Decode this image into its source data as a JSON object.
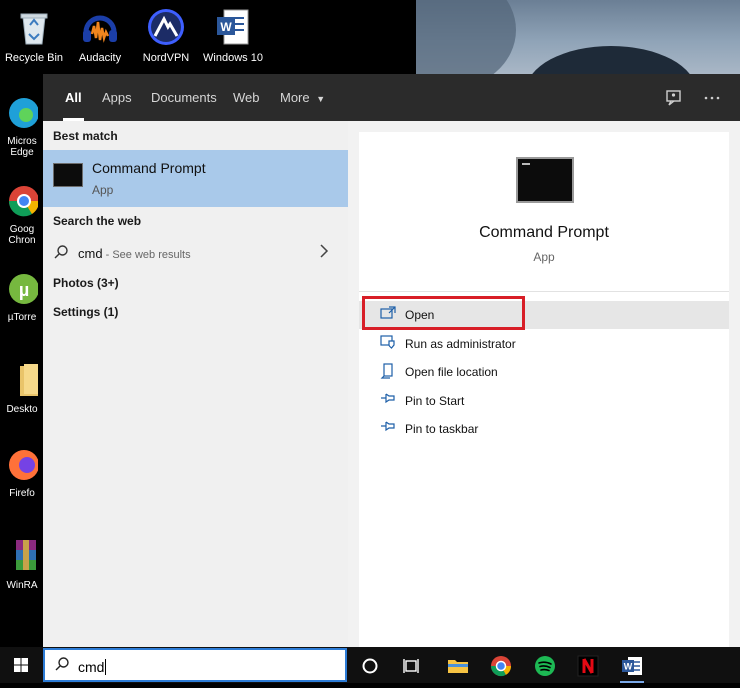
{
  "desktop": {
    "icons": [
      {
        "label": "Recycle Bin",
        "icon": "recycle-bin-icon"
      },
      {
        "label": "Audacity",
        "icon": "audacity-icon"
      },
      {
        "label": "NordVPN",
        "icon": "nordvpn-icon"
      },
      {
        "label": "Windows 10",
        "icon": "word-document-icon"
      }
    ],
    "side_icons": [
      {
        "label": "Micros Edge",
        "line1": "Micros",
        "line2": "Edge",
        "icon": "edge-icon"
      },
      {
        "label": "Goog Chron",
        "line1": "Goog",
        "line2": "Chron",
        "icon": "chrome-icon"
      },
      {
        "label": "µTorre",
        "line1": "µTorre",
        "line2": "",
        "icon": "utorrent-icon"
      },
      {
        "label": "Deskto",
        "line1": "Deskto",
        "line2": "",
        "icon": "folder-icon"
      },
      {
        "label": "Firefo",
        "line1": "Firefo",
        "line2": "",
        "icon": "firefox-icon"
      },
      {
        "label": "WinRA",
        "line1": "WinRA",
        "line2": "",
        "icon": "winrar-icon"
      }
    ]
  },
  "search": {
    "tabs": [
      "All",
      "Apps",
      "Documents",
      "Web",
      "More"
    ],
    "more_arrow": "▼",
    "feedback_icon": "feedback-icon",
    "options_icon": "more-options-icon",
    "best_match_header": "Best match",
    "best_match": {
      "name": "Command Prompt",
      "type": "App"
    },
    "web_header": "Search the web",
    "web_query": "cmd",
    "web_suffix": " - See web results",
    "photos": "Photos (3+)",
    "settings": "Settings (1)",
    "detail": {
      "name": "Command Prompt",
      "type": "App",
      "actions": [
        {
          "label": "Open",
          "icon": "open-icon"
        },
        {
          "label": "Run as administrator",
          "icon": "shield-admin-icon"
        },
        {
          "label": "Open file location",
          "icon": "file-location-icon"
        },
        {
          "label": "Pin to Start",
          "icon": "pin-icon"
        },
        {
          "label": "Pin to taskbar",
          "icon": "pin-icon"
        }
      ]
    },
    "query": "cmd"
  },
  "colors": {
    "selection": "#a9c9ea",
    "highlight_border": "#d81e27",
    "accent": "#2d7cd6"
  },
  "taskbar": {
    "apps": [
      "cortana-icon",
      "task-view-icon",
      "file-explorer-icon",
      "chrome-icon",
      "spotify-icon",
      "netflix-icon",
      "word-icon"
    ]
  }
}
